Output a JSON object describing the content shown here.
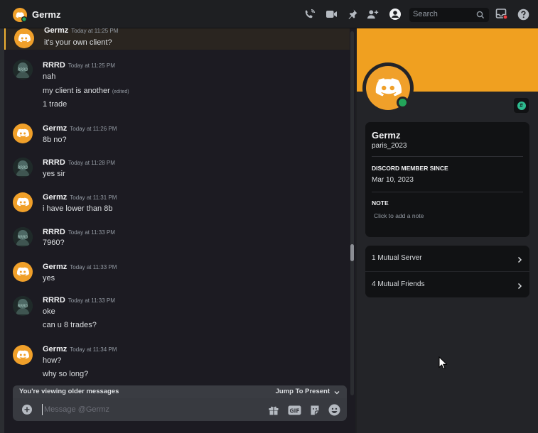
{
  "header": {
    "title": "Germz",
    "search_placeholder": "Search"
  },
  "messages": [
    {
      "author": "Germz",
      "time": "Today at 11:25 PM",
      "lines": [
        "it's your own client?"
      ]
    },
    {
      "author": "RRRD",
      "time": "Today at 11:25 PM",
      "lines": [
        "nah",
        "my client is another",
        "1 trade"
      ],
      "edited_label": "(edited)"
    },
    {
      "author": "Germz",
      "time": "Today at 11:26 PM",
      "lines": [
        "8b no?"
      ]
    },
    {
      "author": "RRRD",
      "time": "Today at 11:28 PM",
      "lines": [
        "yes sir"
      ]
    },
    {
      "author": "Germz",
      "time": "Today at 11:31 PM",
      "lines": [
        "i have lower than 8b"
      ]
    },
    {
      "author": "RRRD",
      "time": "Today at 11:33 PM",
      "lines": [
        "7960?"
      ]
    },
    {
      "author": "Germz",
      "time": "Today at 11:33 PM",
      "lines": [
        "yes"
      ]
    },
    {
      "author": "RRRD",
      "time": "Today at 11:33 PM",
      "lines": [
        "oke",
        "can u 8 trades?"
      ]
    },
    {
      "author": "Germz",
      "time": "Today at 11:34 PM",
      "lines": [
        "how?",
        "why so long?"
      ]
    }
  ],
  "rrrd_avatar_text": "RRRD",
  "older_bar": {
    "text": "You're viewing older messages",
    "jump": "Jump To Present"
  },
  "composer": {
    "placeholder": "Message @Germz",
    "gif_label": "GIF"
  },
  "profile": {
    "display_name": "Germz",
    "username": "paris_2023",
    "member_since_label": "DISCORD MEMBER SINCE",
    "member_since": "Mar 10, 2023",
    "note_label": "NOTE",
    "note_placeholder": "Click to add a note",
    "badge_glyph": "#",
    "status": "online"
  },
  "mutual": {
    "servers": "1 Mutual Server",
    "friends": "4 Mutual Friends"
  },
  "colors": {
    "accent": "#f0a020",
    "online": "#23a55a",
    "highlight": "#f0b132",
    "notification": "#f23f43"
  }
}
